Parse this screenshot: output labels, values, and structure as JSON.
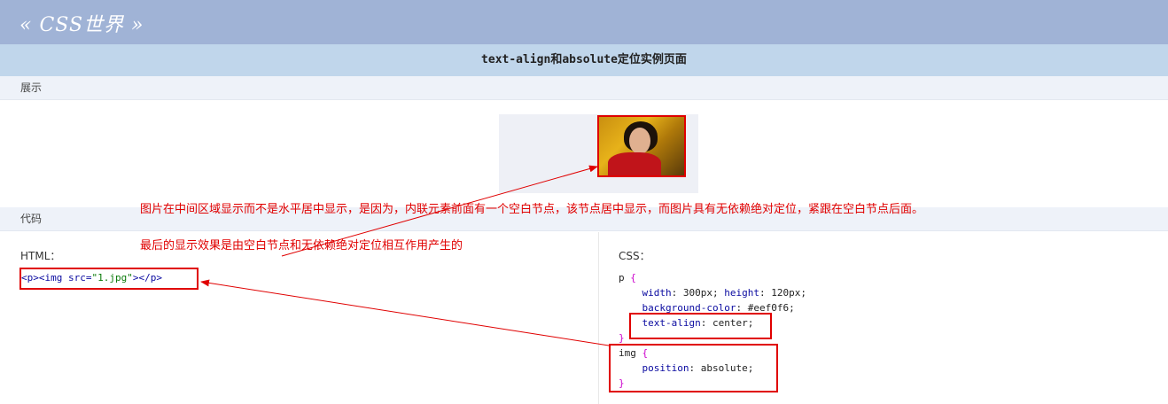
{
  "header": {
    "logo": "« CSS世界 »"
  },
  "title": "text-align和absolute定位实例页面",
  "sections": {
    "demo": "展示",
    "code": "代码"
  },
  "annotations": {
    "line1": "图片在中间区域显示而不是水平居中显示，是因为，内联元素前面有一个空白节点，该节点居中显示，而图片具有无依赖绝对定位，紧跟在空白节点后面。",
    "line2": "最后的显示效果是由空白节点和无依赖绝对定位相互作用产生的"
  },
  "html_panel": {
    "label": "HTML：",
    "code": {
      "open_p": "<p>",
      "img_open": "<img ",
      "attr": "src=",
      "value": "\"1.jpg\"",
      "close": "></p>"
    }
  },
  "css_panel": {
    "label": "CSS：",
    "p_selector": "p",
    "p_rules": [
      {
        "prop": "width",
        "value": "300px; ",
        "prop2": "height",
        "value2": "120px;"
      },
      {
        "prop": "background-color",
        "value": "#eef0f6;"
      },
      {
        "prop": "text-align",
        "value": "center;"
      }
    ],
    "img_selector": "img",
    "img_rules": [
      {
        "prop": "position",
        "value": "absolute;"
      }
    ]
  },
  "colors": {
    "topbar": "#a0b3d6",
    "titlebar": "#c0d6eb",
    "section": "#eef2f9",
    "annotation": "#e00000"
  }
}
